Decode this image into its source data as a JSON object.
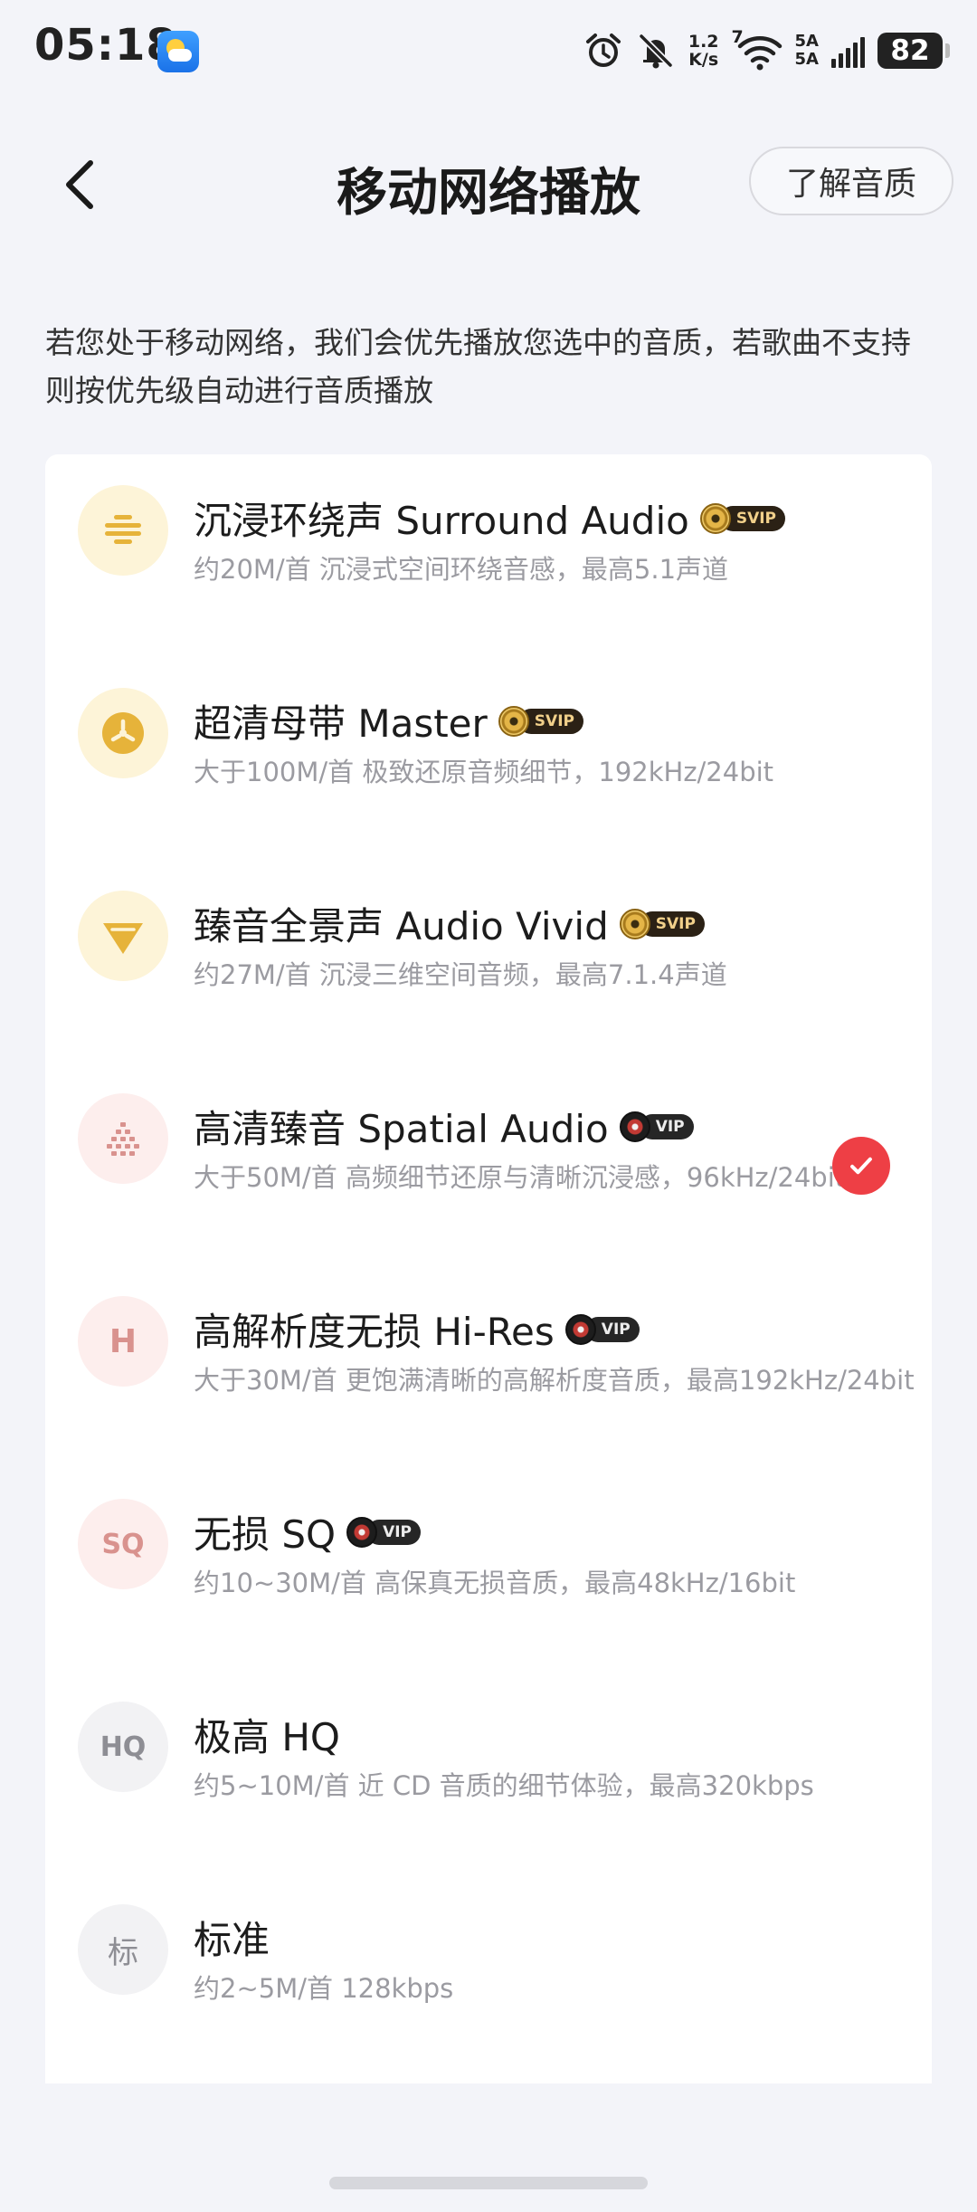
{
  "status_bar": {
    "time": "05:18",
    "net_speed_value": "1.2",
    "net_speed_unit": "K/s",
    "wifi_label": "7",
    "sim1": "5A",
    "sim2": "5A",
    "battery": "82"
  },
  "header": {
    "title": "移动网络播放",
    "learn_button": "了解音质"
  },
  "description": "若您处于移动网络，我们会优先播放您选中的音质，若歌曲不支持则按优先级自动进行音质播放",
  "options": [
    {
      "title": "沉浸环绕声 Surround Audio",
      "badge": "SVIP",
      "desc": "约20M/首 沉浸式空间环绕音感，最高5.1声道",
      "icon": "surround-icon"
    },
    {
      "title": "超清母带 Master",
      "badge": "SVIP",
      "desc": "大于100M/首 极致还原音频细节，192kHz/24bit",
      "icon": "master-disc-icon"
    },
    {
      "title": "臻音全景声 Audio Vivid",
      "badge": "SVIP",
      "desc": "约27M/首 沉浸三维空间音频，最高7.1.4声道",
      "icon": "vivid-triangle-icon"
    },
    {
      "title": "高清臻音 Spatial Audio",
      "badge": "VIP",
      "desc": "大于50M/首 高频细节还原与清晰沉浸感，96kHz/24bit",
      "icon": "spatial-dots-icon",
      "selected": true
    },
    {
      "title": "高解析度无损 Hi-Res",
      "badge": "VIP",
      "desc": "大于30M/首 更饱满清晰的高解析度音质，最高192kHz/24bit",
      "icon": "hires-icon",
      "icon_text": "H"
    },
    {
      "title": "无损 SQ",
      "badge": "VIP",
      "desc": "约10~30M/首 高保真无损音质，最高48kHz/16bit",
      "icon": "sq-icon",
      "icon_text": "SQ"
    },
    {
      "title": "极高 HQ",
      "desc": "约5~10M/首 近 CD 音质的细节体验，最高320kbps",
      "icon": "hq-icon",
      "icon_text": "HQ"
    },
    {
      "title": "标准",
      "desc": "约2~5M/首 128kbps",
      "icon": "standard-icon",
      "icon_text": "标"
    }
  ],
  "colors": {
    "background": "#f3f4f9",
    "accent_red": "#ee3f45",
    "gold": "#e6b33a",
    "svip_badge": "#2b2115",
    "vip_badge": "#262626"
  }
}
